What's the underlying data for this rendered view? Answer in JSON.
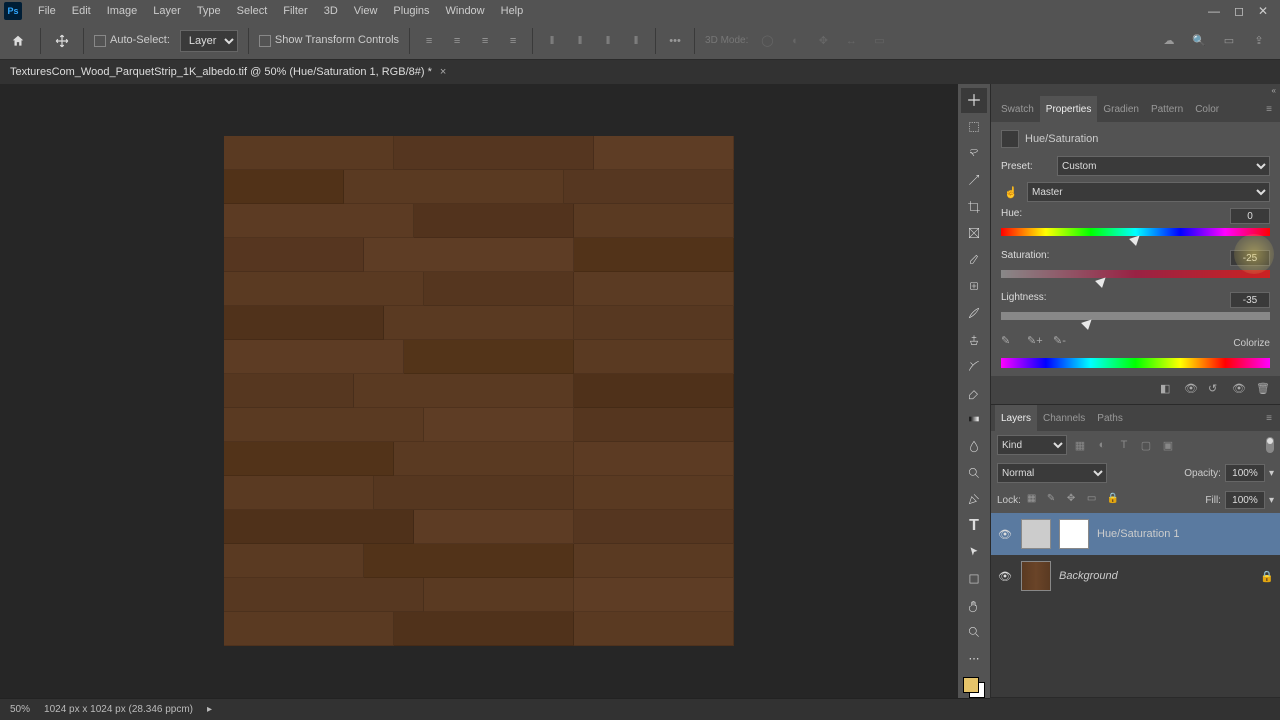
{
  "menu": [
    "File",
    "Edit",
    "Image",
    "Layer",
    "Type",
    "Select",
    "Filter",
    "3D",
    "View",
    "Plugins",
    "Window",
    "Help"
  ],
  "optbar": {
    "auto_select": "Auto-Select:",
    "layer_dd": "Layer",
    "show_transform": "Show Transform Controls",
    "mode3d": "3D Mode:"
  },
  "doc": {
    "title": "TexturesCom_Wood_ParquetStrip_1K_albedo.tif @ 50% (Hue/Saturation 1, RGB/8#) *"
  },
  "panels": {
    "top_tabs": [
      "Swatch",
      "Properties",
      "Gradien",
      "Pattern",
      "Color"
    ],
    "bottom_tabs": [
      "Layers",
      "Channels",
      "Paths"
    ]
  },
  "props": {
    "title": "Hue/Saturation",
    "preset_label": "Preset:",
    "preset_value": "Custom",
    "channel_value": "Master",
    "hue_label": "Hue:",
    "hue_value": "0",
    "sat_label": "Saturation:",
    "sat_value": "-25",
    "light_label": "Lightness:",
    "light_value": "-35",
    "colorize": "Colorize"
  },
  "layers": {
    "kind": "Kind",
    "blend": "Normal",
    "opacity_label": "Opacity:",
    "opacity_value": "100%",
    "lock_label": "Lock:",
    "fill_label": "Fill:",
    "fill_value": "100%",
    "items": [
      {
        "name": "Hue/Saturation 1",
        "locked": false,
        "selected": true,
        "adj": true
      },
      {
        "name": "Background",
        "locked": true,
        "selected": false,
        "adj": false
      }
    ]
  },
  "status": {
    "zoom": "50%",
    "dims": "1024 px x 1024 px (28.346 ppcm)"
  },
  "chart_data": {
    "type": "table",
    "title": "Hue/Saturation adjustment",
    "series": [
      {
        "name": "Hue",
        "values": [
          0
        ],
        "range": [
          -180,
          180
        ]
      },
      {
        "name": "Saturation",
        "values": [
          -25
        ],
        "range": [
          -100,
          100
        ]
      },
      {
        "name": "Lightness",
        "values": [
          -35
        ],
        "range": [
          -100,
          100
        ]
      }
    ]
  }
}
